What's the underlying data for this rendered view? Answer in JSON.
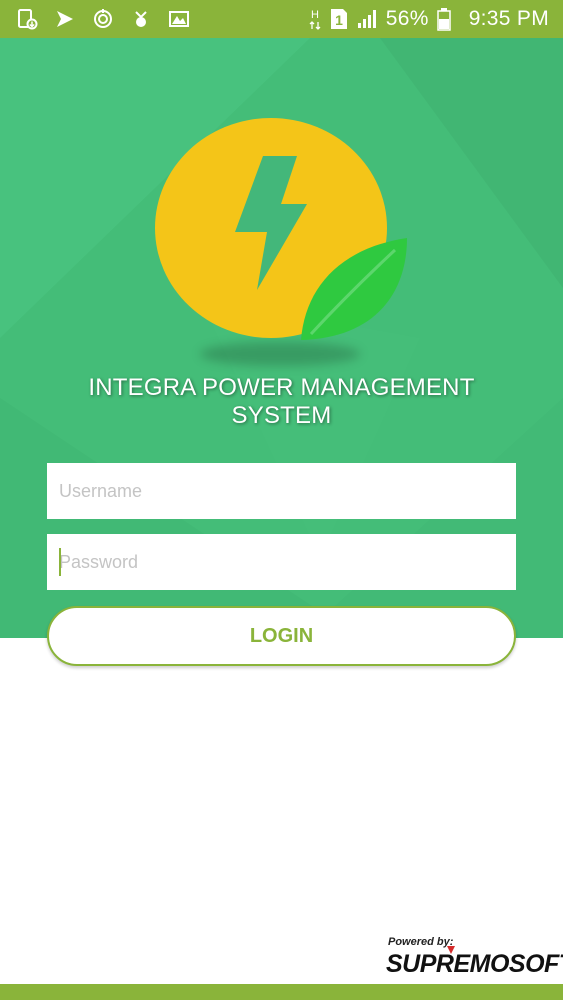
{
  "status_bar": {
    "battery_percent": "56%",
    "time": "9:35 PM",
    "network_type": "H",
    "sim_slot": "1",
    "icons": [
      "download-icon",
      "play-icon",
      "sync-icon",
      "notification-icon",
      "gallery-icon",
      "network-h-icon",
      "sim-icon",
      "signal-icon",
      "battery-icon"
    ]
  },
  "app": {
    "title_line1": "INTEGRA POWER MANAGEMENT",
    "title_line2": "SYSTEM"
  },
  "login_form": {
    "username_placeholder": "Username",
    "username_value": "",
    "password_placeholder": "Password",
    "password_value": "",
    "login_label": "LOGIN"
  },
  "footer": {
    "powered_by": "Powered by:",
    "brand": "SUPREMOSOFT"
  },
  "colors": {
    "status_bar": "#8ab43a",
    "hero_background": "#44bd78",
    "logo_circle": "#f4c518",
    "bolt": "#43b77a",
    "leaf": "#2fc940",
    "accent": "#8ab43a",
    "brand_accent": "#d52b2b"
  }
}
